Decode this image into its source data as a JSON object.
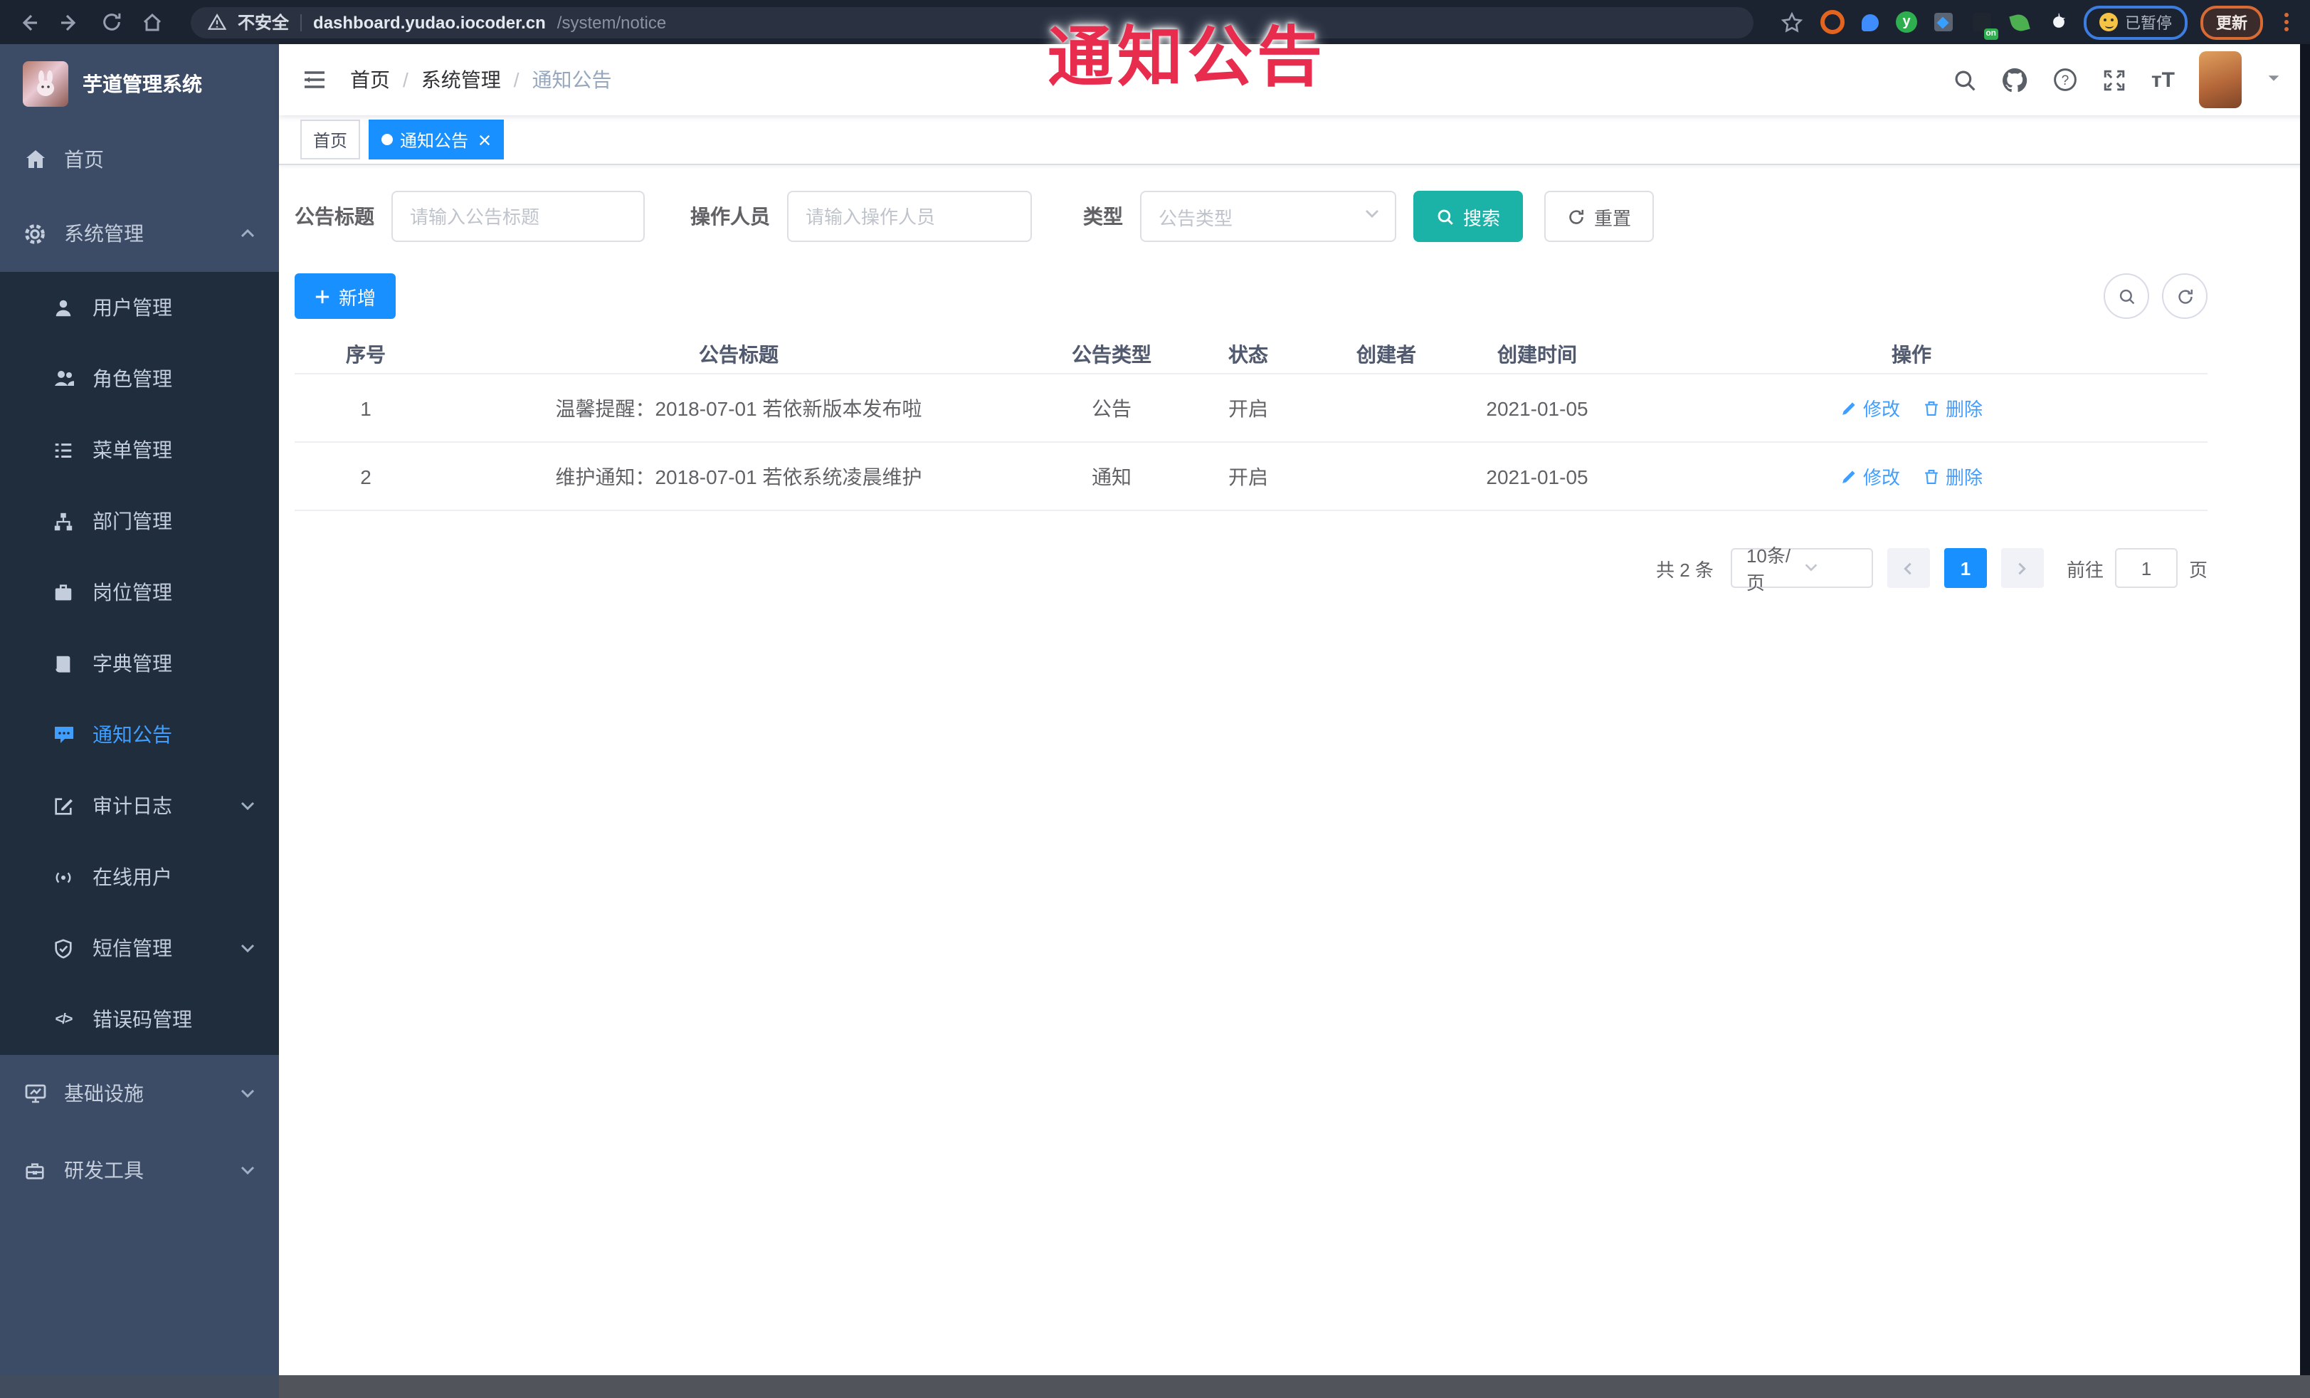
{
  "browser": {
    "security_warning": "不安全",
    "url_domain": "dashboard.yudao.iocoder.cn",
    "url_path": "/system/notice",
    "paused_badge": "已暂停",
    "update_button": "更新",
    "ext_on_badge": "on"
  },
  "overlay": {
    "title": "通知公告",
    "color": "#e82c4e"
  },
  "sidebar": {
    "logo_title": "芋道管理系统",
    "items": [
      {
        "label": "首页",
        "icon": "home-icon"
      },
      {
        "label": "系统管理",
        "icon": "gear-icon",
        "expanded": true
      },
      {
        "label": "用户管理",
        "icon": "user-icon"
      },
      {
        "label": "角色管理",
        "icon": "users-icon"
      },
      {
        "label": "菜单管理",
        "icon": "menu-list-icon"
      },
      {
        "label": "部门管理",
        "icon": "org-tree-icon"
      },
      {
        "label": "岗位管理",
        "icon": "briefcase-icon"
      },
      {
        "label": "字典管理",
        "icon": "book-icon"
      },
      {
        "label": "通知公告",
        "icon": "message-icon",
        "active": true
      },
      {
        "label": "审计日志",
        "icon": "edit-icon",
        "collapsible": true
      },
      {
        "label": "在线用户",
        "icon": "online-icon"
      },
      {
        "label": "短信管理",
        "icon": "shield-icon",
        "collapsible": true
      },
      {
        "label": "错误码管理",
        "icon": "code-icon"
      },
      {
        "label": "基础设施",
        "icon": "monitor-icon",
        "collapsible": true
      },
      {
        "label": "研发工具",
        "icon": "toolbox-icon",
        "collapsible": true
      }
    ]
  },
  "navbar": {
    "breadcrumb": [
      "首页",
      "系统管理",
      "通知公告"
    ]
  },
  "tags": [
    {
      "label": "首页",
      "active": false
    },
    {
      "label": "通知公告",
      "active": true,
      "closable": true
    }
  ],
  "filters": {
    "title_label": "公告标题",
    "title_placeholder": "请输入公告标题",
    "operator_label": "操作人员",
    "operator_placeholder": "请输入操作人员",
    "type_label": "类型",
    "type_placeholder": "公告类型",
    "search_label": "搜索",
    "reset_label": "重置"
  },
  "toolbar": {
    "add_label": "新增"
  },
  "table": {
    "columns": [
      "序号",
      "公告标题",
      "公告类型",
      "状态",
      "创建者",
      "创建时间",
      "操作"
    ],
    "rows": [
      {
        "no": "1",
        "title": "温馨提醒：2018-07-01 若依新版本发布啦",
        "type": "公告",
        "status": "开启",
        "creator": "",
        "created": "2021-01-05",
        "edit_label": "修改",
        "delete_label": "删除"
      },
      {
        "no": "2",
        "title": "维护通知：2018-07-01 若依系统凌晨维护",
        "type": "通知",
        "status": "开启",
        "creator": "",
        "created": "2021-01-05",
        "edit_label": "修改",
        "delete_label": "删除"
      }
    ]
  },
  "pagination": {
    "total_text": "共 2 条",
    "page_size": "10条/页",
    "current_page": "1",
    "goto_label": "前往",
    "goto_value": "1",
    "page_unit": "页"
  },
  "icons": {
    "code_glyph": "</>",
    "fontsize_glyph": "тT"
  },
  "colors": {
    "primary_blue": "#1890ff",
    "link_blue": "#409EFF",
    "search_teal": "#1bb3a8",
    "sidebar_bg": "#3d4c66",
    "submenu_bg": "#1f2d3d",
    "active_text": "#409EFF",
    "overlay_red": "#e82c4e"
  }
}
